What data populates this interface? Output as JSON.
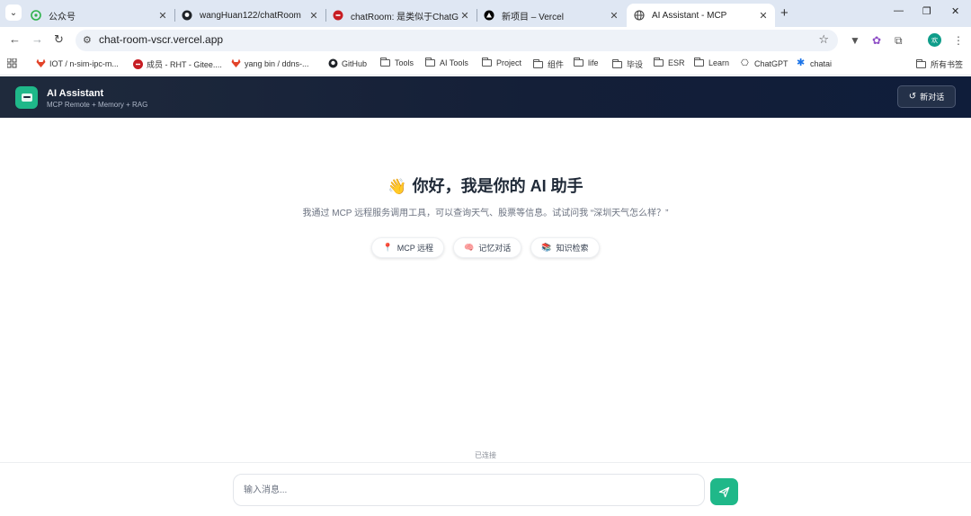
{
  "browser": {
    "tabs": [
      {
        "label": "公众号",
        "icon": "wechat-icon",
        "active": false
      },
      {
        "label": "wangHuan122/chatRoom",
        "icon": "github-icon",
        "active": false
      },
      {
        "label": "chatRoom: 是类似于ChatGPT的",
        "icon": "gitee-icon",
        "active": false
      },
      {
        "label": "新项目 – Vercel",
        "icon": "vercel-icon",
        "active": false
      },
      {
        "label": "AI Assistant - MCP",
        "icon": "globe-icon",
        "active": true
      }
    ],
    "url": "chat-room-vscr.vercel.app",
    "profile_initial": "欢",
    "bookmarks": [
      {
        "label": "IOT / n-sim-ipc-m...",
        "icon": "gitlab-icon"
      },
      {
        "label": "成员 - RHT - Gitee....",
        "icon": "gitee-icon"
      },
      {
        "label": "yang bin / ddns-...",
        "icon": "gitlab-icon"
      },
      {
        "label": "GitHub",
        "icon": "github-icon"
      },
      {
        "label": "Tools",
        "icon": "folder-icon"
      },
      {
        "label": "AI Tools",
        "icon": "folder-icon"
      },
      {
        "label": "Project",
        "icon": "folder-icon"
      },
      {
        "label": "组件",
        "icon": "folder-icon"
      },
      {
        "label": "life",
        "icon": "folder-icon"
      },
      {
        "label": "毕设",
        "icon": "folder-icon"
      },
      {
        "label": "ESR",
        "icon": "folder-icon"
      },
      {
        "label": "Learn",
        "icon": "folder-icon"
      },
      {
        "label": "ChatGPT",
        "icon": "openai-icon"
      },
      {
        "label": "chatai",
        "icon": "asterisk-icon"
      }
    ],
    "all_bookmarks": "所有书签"
  },
  "app": {
    "title": "AI Assistant",
    "subtitle": "MCP Remote + Memory + RAG",
    "new_chat": "新对话",
    "accent": "#1fb889"
  },
  "hero": {
    "emoji": "👋",
    "title": "你好，我是你的 AI 助手",
    "description": "我通过 MCP 远程服务调用工具，可以查询天气、股票等信息。试试问我 “深圳天气怎么样？”"
  },
  "chips": [
    {
      "label": "MCP 远程",
      "icon": "pin-icon"
    },
    {
      "label": "记忆对话",
      "icon": "brain-icon"
    },
    {
      "label": "知识检索",
      "icon": "books-icon"
    }
  ],
  "status": "已连接",
  "composer": {
    "placeholder": "输入消息..."
  }
}
